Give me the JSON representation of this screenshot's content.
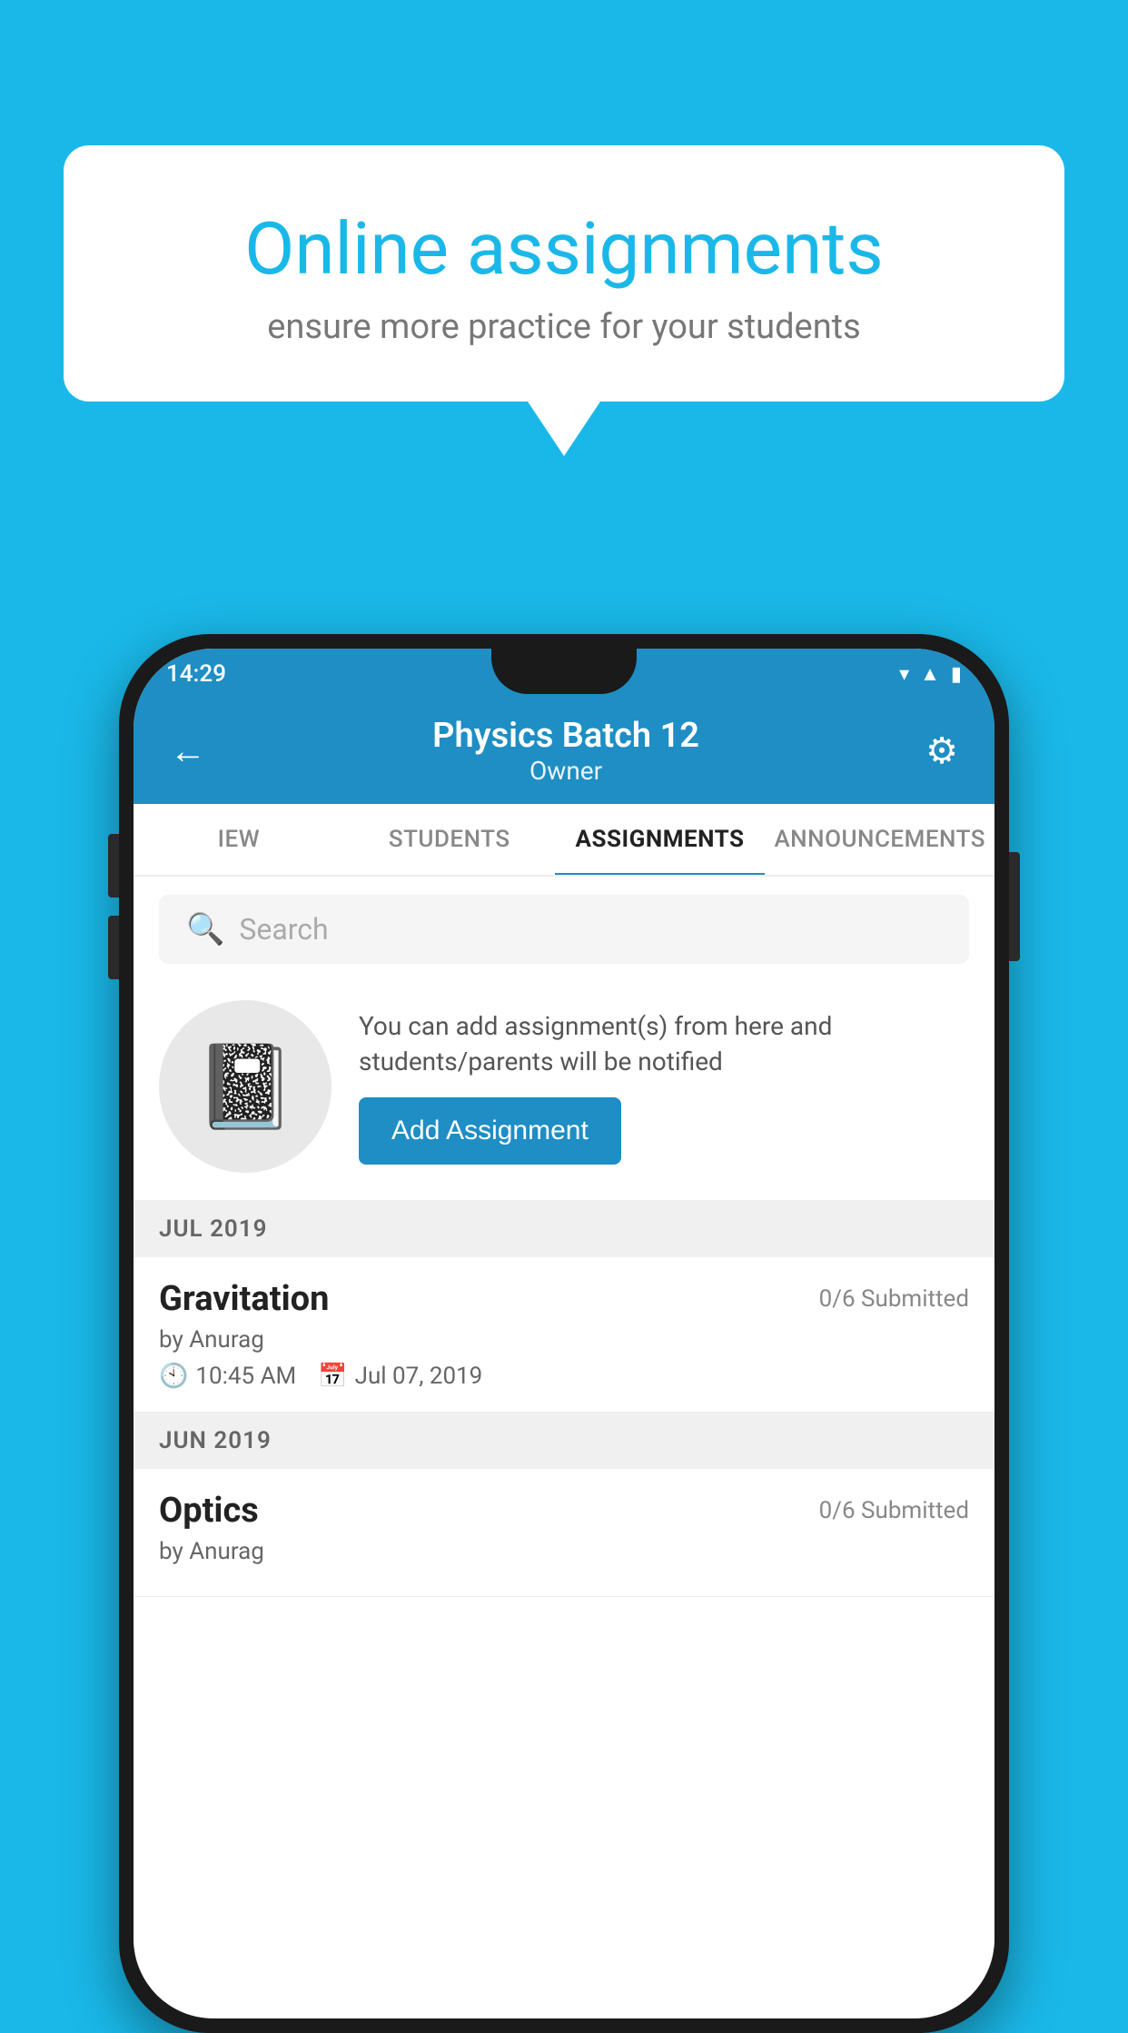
{
  "background_color": "#1ab8e8",
  "speech_bubble": {
    "title": "Online assignments",
    "subtitle": "ensure more practice for your students"
  },
  "phone": {
    "status_bar": {
      "time": "14:29",
      "icons": [
        "wifi",
        "signal",
        "battery"
      ]
    },
    "header": {
      "title": "Physics Batch 12",
      "subtitle": "Owner",
      "back_label": "←",
      "gear_label": "⚙"
    },
    "tabs": [
      {
        "label": "IEW",
        "active": false
      },
      {
        "label": "STUDENTS",
        "active": false
      },
      {
        "label": "ASSIGNMENTS",
        "active": true
      },
      {
        "label": "ANNOUNCEMENTS",
        "active": false
      }
    ],
    "search": {
      "placeholder": "Search"
    },
    "assignment_prompt": {
      "description": "You can add assignment(s) from here and students/parents will be notified",
      "button_label": "Add Assignment"
    },
    "sections": [
      {
        "label": "JUL 2019",
        "items": [
          {
            "name": "Gravitation",
            "submitted": "0/6 Submitted",
            "by": "by Anurag",
            "time": "10:45 AM",
            "date": "Jul 07, 2019"
          }
        ]
      },
      {
        "label": "JUN 2019",
        "items": [
          {
            "name": "Optics",
            "submitted": "0/6 Submitted",
            "by": "by Anurag",
            "time": "",
            "date": ""
          }
        ]
      }
    ]
  }
}
